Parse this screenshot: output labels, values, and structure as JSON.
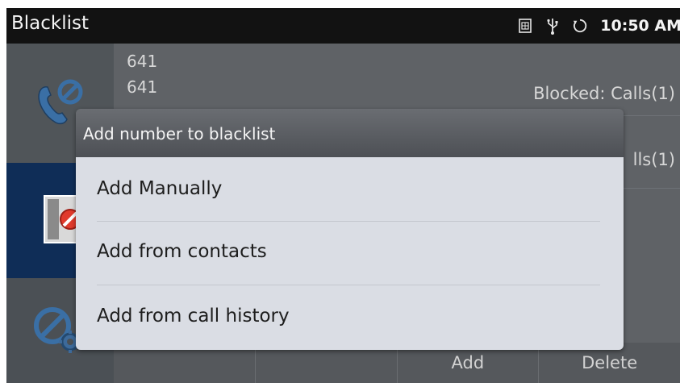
{
  "status_bar": {
    "title": "Blacklist",
    "time": "10:50 AM",
    "icons": [
      "sim-card-icon",
      "usb-icon",
      "sync-icon"
    ]
  },
  "sidebar": {
    "tabs": [
      {
        "icon": "blocked-call-icon",
        "selected": false
      },
      {
        "icon": "blocked-contact-card-icon",
        "selected": true
      },
      {
        "icon": "blacklist-settings-icon",
        "selected": false
      }
    ]
  },
  "list": {
    "rows": [
      {
        "name": "641",
        "number": "641",
        "status": "Blocked: Calls(1)"
      },
      {
        "name": "",
        "number": "",
        "status": "lls(1)"
      }
    ]
  },
  "bottom_bar": {
    "buttons": [
      "",
      "",
      "Add",
      "Delete"
    ]
  },
  "dialog": {
    "title": "Add number to blacklist",
    "options": [
      "Add Manually",
      "Add from contacts",
      "Add from call history"
    ]
  },
  "colors": {
    "status_bar_bg": "#121212",
    "selected_tab_bg": "#0f2d57",
    "dialog_body_bg": "#dadde4"
  }
}
